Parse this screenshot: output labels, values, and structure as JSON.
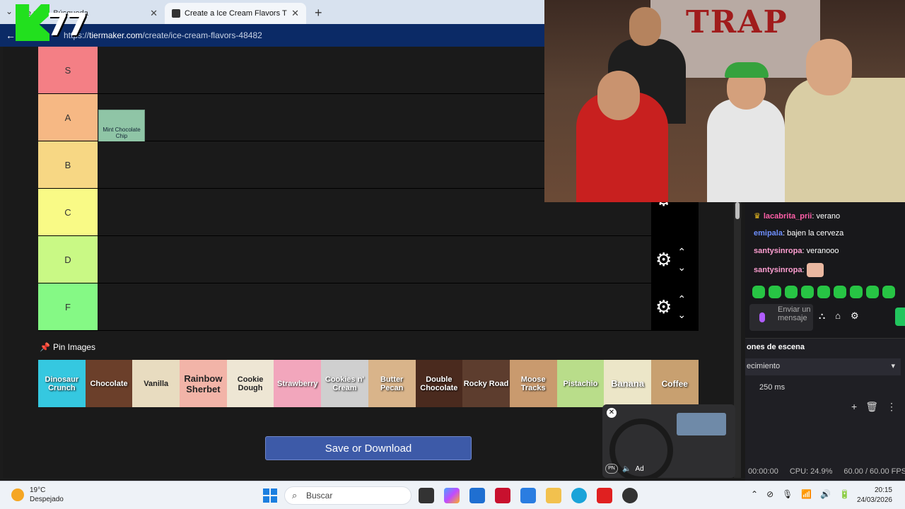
{
  "browser": {
    "tabs": [
      {
        "label": "e pr... - Búsqueda",
        "active": false
      },
      {
        "label": "Create a Ice Cream Flavors Tier List",
        "active": true
      }
    ],
    "url_prefix": "https://",
    "url_domain": "tiermaker.com",
    "url_path": "/create/ice-cream-flavors-48482",
    "new_tab": "+",
    "close": "✕"
  },
  "overlay_logo": {
    "number": "77"
  },
  "tierlist": {
    "tiers": [
      {
        "label": "S",
        "color": "#f47f85"
      },
      {
        "label": "A",
        "color": "#f6b884"
      },
      {
        "label": "B",
        "color": "#f7d784"
      },
      {
        "label": "C",
        "color": "#f9fa86"
      },
      {
        "label": "D",
        "color": "#c9f985"
      },
      {
        "label": "F",
        "color": "#85f985"
      }
    ],
    "placed_items": {
      "A": [
        "Mint Chocolate Chip"
      ]
    }
  },
  "pin_images_label": "Pin Images",
  "flavors": [
    {
      "label": "Dinosaur Crunch",
      "color": "#35c8e0"
    },
    {
      "label": "Chocolate",
      "color": "#6b3f2a"
    },
    {
      "label": "Vanilla",
      "color": "#e8dcc0"
    },
    {
      "label": "Rainbow Sherbet",
      "color": "#f2b4a8"
    },
    {
      "label": "Cookie Dough",
      "color": "#eee6d4"
    },
    {
      "label": "Strawberry",
      "color": "#f2a6bc"
    },
    {
      "label": "Cookies n' Cream",
      "color": "#cfcfcf"
    },
    {
      "label": "Butter Pecan",
      "color": "#d9b48a"
    },
    {
      "label": "Double Chocolate",
      "color": "#4a2a1e"
    },
    {
      "label": "Rocky Road",
      "color": "#5d3d2e"
    },
    {
      "label": "Moose Tracks",
      "color": "#c99a6e"
    },
    {
      "label": "Pistachio",
      "color": "#b9dd8a"
    },
    {
      "label": "Banana",
      "color": "#ece6c8"
    },
    {
      "label": "Coffee",
      "color": "#c8a070"
    }
  ],
  "save_button": "Save or Download",
  "chat": {
    "messages": [
      {
        "user": "lacabrita_prii",
        "text": "verano"
      },
      {
        "user": "emipala",
        "text": "bajen la cerveza"
      },
      {
        "user": "santysinropa",
        "text": "veranooo"
      },
      {
        "user": "santysinropa",
        "text": ""
      }
    ],
    "input_placeholder": "Enviar un mensaje"
  },
  "obs": {
    "section_title": "ones de escena",
    "transition": "ecimiento",
    "duration": "250 ms",
    "status_time": "00:00:00",
    "status_cpu": "CPU: 24.9%",
    "status_fps": "60.00 / 60.00 FPS"
  },
  "mini_player": {
    "ad_label": "Ad"
  },
  "taskbar": {
    "temperature": "19°C",
    "weather": "Despejado",
    "search_placeholder": "Buscar",
    "time": "20:15",
    "date": "24/03/2026"
  }
}
